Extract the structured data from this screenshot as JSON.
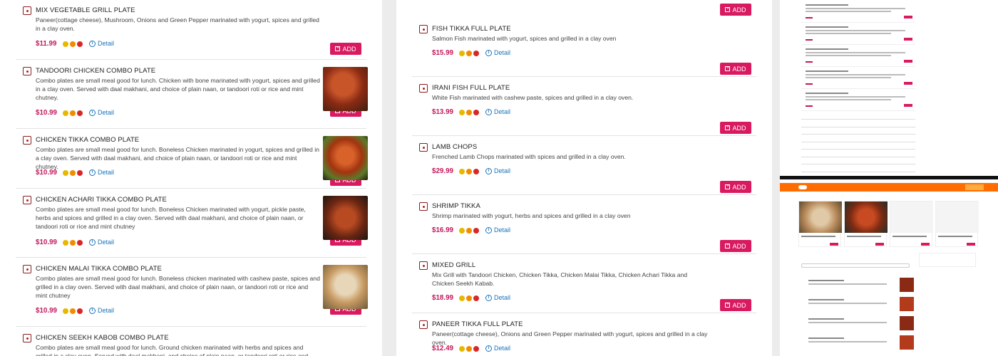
{
  "left_items": [
    {
      "name": "MIX VEGETABLE GRILL PLATE",
      "desc": "Paneer(cottage cheese), Mushroom, Onions and Green Pepper marinated with yogurt, spices and grilled in a clay oven.",
      "price": "$11.99",
      "detail": "Detail",
      "add": "ADD",
      "image": false
    },
    {
      "name": "TANDOORI CHICKEN COMBO PLATE",
      "desc": "Combo plates are small meal good for lunch. Chicken with bone marinated with yogurt, spices and grilled in a clay oven. Served with daal makhani, and choice of plain naan, or tandoori roti or rice and mint chutney.",
      "price": "$10.99",
      "detail": "Detail",
      "add": "ADD",
      "image": true
    },
    {
      "name": "CHICKEN TIKKA COMBO PLATE",
      "desc": "Combo plates are small meal good for lunch. Boneless Chicken marinated in yogurt, spices and grilled in a clay oven. Served with daal makhani, and choice of plain naan, or tandoori roti or rice and mint chutney.",
      "price": "$10.99",
      "detail": "Detail",
      "add": "ADD",
      "image": true
    },
    {
      "name": "CHICKEN ACHARI TIKKA COMBO PLATE",
      "desc": "Combo plates are small meal good for lunch. Boneless Chicken marinated with yogurt, pickle paste, herbs and spices and grilled in a clay oven. Served with daal makhani, and choice of plain naan, or tandoori roti or rice and mint chutney",
      "price": "$10.99",
      "detail": "Detail",
      "add": "ADD",
      "image": true
    },
    {
      "name": "CHICKEN MALAI TIKKA COMBO PLATE",
      "desc": "Combo plates are small meal good for lunch. Boneless chicken marinated with cashew paste, spices and grilled in a clay oven. Served with daal makhani, and choice of plain naan, or tandoori roti or rice and mint chutney",
      "price": "$10.99",
      "detail": "Detail",
      "add": "ADD",
      "image": true
    },
    {
      "name": "CHICKEN SEEKH KABOB COMBO PLATE",
      "desc": "Combo plates are small meal good for lunch. Ground chicken marinated with herbs and spices and grilled in a clay oven. Served with daal makhani, and choice of plain naan, or tandoori roti or rice and mint",
      "price": "",
      "detail": "",
      "add": "",
      "image": false
    }
  ],
  "mid_top_add": "ADD",
  "mid_items": [
    {
      "name": "FISH TIKKA FULL PLATE",
      "desc": "Salmon Fish marinated with yogurt, spices and grilled in a clay oven",
      "price": "$15.99",
      "detail": "Detail",
      "add": "ADD"
    },
    {
      "name": "IRANI FISH FULL PLATE",
      "desc": "White Fish marinated with cashew paste, spices and grilled in a clay oven.",
      "price": "$13.99",
      "detail": "Detail",
      "add": "ADD"
    },
    {
      "name": "LAMB CHOPS",
      "desc": "Frenched Lamb Chops marinated with spices and grilled in a clay oven.",
      "price": "$29.99",
      "detail": "Detail",
      "add": "ADD"
    },
    {
      "name": "SHRIMP TIKKA",
      "desc": "Shrimp marinated with yogurt, herbs and spices and grilled in a clay oven",
      "price": "$16.99",
      "detail": "Detail",
      "add": "ADD"
    },
    {
      "name": "MIXED GRILL",
      "desc": "Mix Grill with Tandoori Chicken, Chicken Tikka, Chicken Malai Tikka, Chicken Achari Tikka and Chicken Seekh Kabab.",
      "price": "$18.99",
      "detail": "Detail",
      "add": "ADD"
    },
    {
      "name": "PANEER TIKKA FULL PLATE",
      "desc": "Paneer(cottage cheese), Onions and Green Pepper marinated with yogurt, spices and grilled in a clay oven.",
      "price": "$12.49",
      "detail": "Detail",
      "add": "ADD"
    }
  ],
  "spice_colors": [
    "#e6b800",
    "#f08c00",
    "#d62828"
  ],
  "colors": {
    "price": "#c2185b",
    "add_button": "#d81b60",
    "detail_link": "#1a73b8",
    "header": "#ff6d00"
  },
  "icons": {
    "veg_mark": "veg-nonveg-mark-icon",
    "detail": "info-circle-icon",
    "add": "plus-square-icon"
  }
}
